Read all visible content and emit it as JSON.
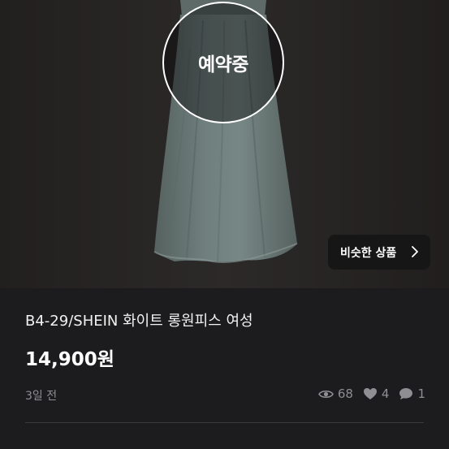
{
  "product": {
    "reserved_label": "예약중",
    "similar_button_label": "비슷한 상품",
    "title": "B4-29/SHEIN 화이트 롱원피스 여성",
    "price": "14,900원",
    "posted_time": "3일 전"
  },
  "stats": {
    "views": "68",
    "likes": "4",
    "chats": "1"
  },
  "icons": {
    "views": "eye-icon",
    "likes": "heart-icon",
    "chats": "chat-bubble-icon",
    "similar": "chevron-right-icon"
  },
  "colors": {
    "background": "#1c1c1e",
    "photo_background": "#262424",
    "dress": "#6b7b79",
    "secondary_text": "#8e8e93"
  }
}
